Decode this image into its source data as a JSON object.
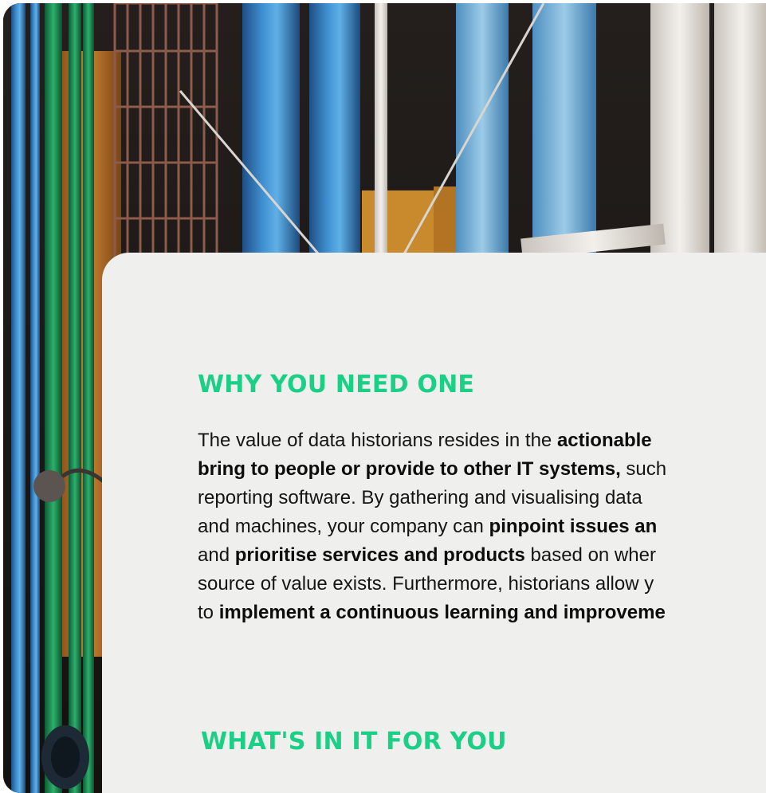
{
  "section1": {
    "heading": "WHY YOU NEED ONE",
    "lines": [
      [
        {
          "t": "The value of data historians resides in the ",
          "b": false
        },
        {
          "t": "actionable",
          "b": true
        }
      ],
      [
        {
          "t": "bring to people or provide to other IT systems,",
          "b": true
        },
        {
          "t": " such",
          "b": false
        }
      ],
      [
        {
          "t": "reporting software. By gathering and visualising data",
          "b": false
        }
      ],
      [
        {
          "t": "and machines, your company can ",
          "b": false
        },
        {
          "t": "pinpoint issues an",
          "b": true
        }
      ],
      [
        {
          "t": "and ",
          "b": false
        },
        {
          "t": "prioritise services and products",
          "b": true
        },
        {
          "t": " based on wher",
          "b": false
        }
      ],
      [
        {
          "t": "source of value exists. Furthermore, historians allow y",
          "b": false
        }
      ],
      [
        {
          "t": "to ",
          "b": false
        },
        {
          "t": "implement a continuous learning and improveme",
          "b": true
        }
      ]
    ]
  },
  "section2": {
    "heading": "WHAT'S IN IT FOR YOU"
  },
  "colors": {
    "accent": "#1ccf86",
    "card": "#efefed",
    "text": "#151515"
  }
}
